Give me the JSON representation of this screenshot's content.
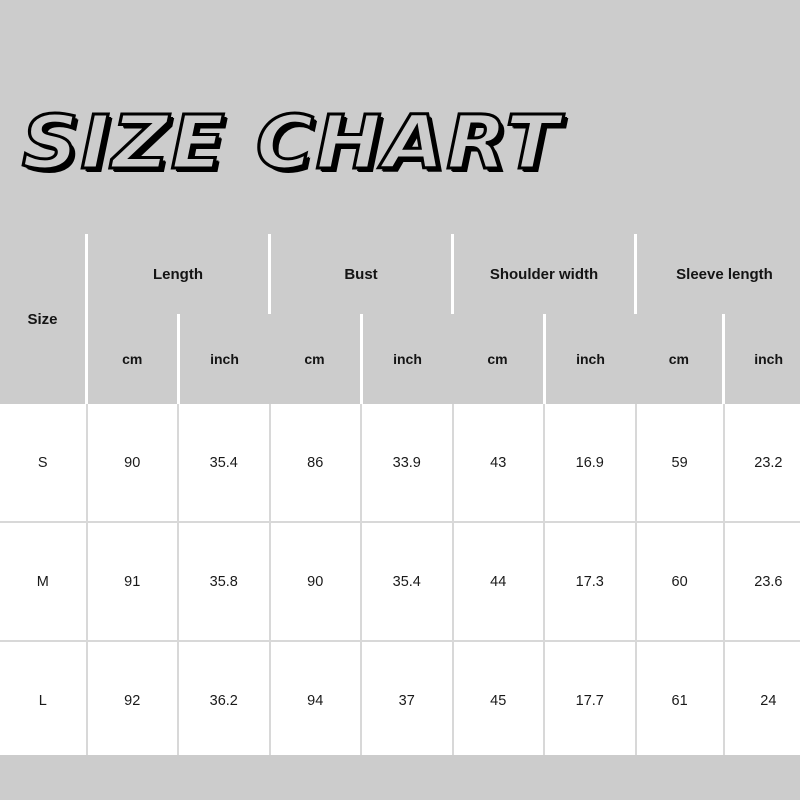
{
  "title": {
    "text": "SIZE CHART"
  },
  "table": {
    "size_header": "Size",
    "groups": [
      {
        "label": "Length",
        "units": [
          "cm",
          "inch"
        ]
      },
      {
        "label": "Bust",
        "units": [
          "cm",
          "inch"
        ]
      },
      {
        "label": "Shoulder width",
        "units": [
          "cm",
          "inch"
        ]
      },
      {
        "label": "Sleeve length",
        "units": [
          "cm",
          "inch"
        ]
      }
    ],
    "rows": [
      {
        "size": "S",
        "length_cm": "90",
        "length_inch": "35.4",
        "bust_cm": "86",
        "bust_inch": "33.9",
        "shoulder_cm": "43",
        "shoulder_inch": "16.9",
        "sleeve_cm": "59",
        "sleeve_inch": "23.2"
      },
      {
        "size": "M",
        "length_cm": "91",
        "length_inch": "35.8",
        "bust_cm": "90",
        "bust_inch": "35.4",
        "shoulder_cm": "44",
        "shoulder_inch": "17.3",
        "sleeve_cm": "60",
        "sleeve_inch": "23.6"
      },
      {
        "size": "L",
        "length_cm": "92",
        "length_inch": "36.2",
        "bust_cm": "94",
        "bust_inch": "37",
        "shoulder_cm": "45",
        "shoulder_inch": "17.7",
        "sleeve_cm": "61",
        "sleeve_inch": "24"
      }
    ]
  },
  "colors": {
    "background": "#cccccc",
    "table_body": "#ffffff",
    "header_divider": "#ffffff",
    "body_divider": "#d8d8d8",
    "text": "#141414"
  }
}
